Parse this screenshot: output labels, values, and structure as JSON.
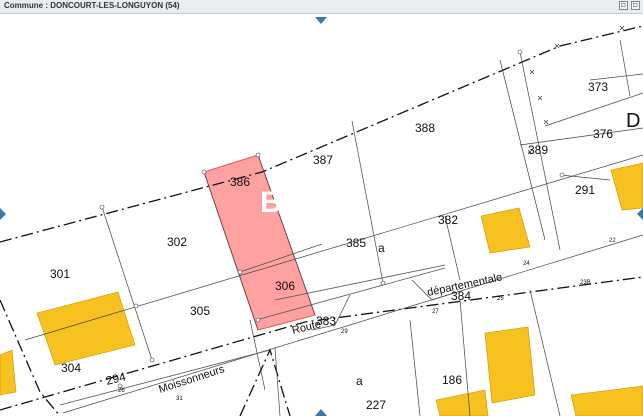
{
  "window": {
    "title": "Commune : DONCOURT-LES-LONGUYON (54)",
    "buttons": [
      {
        "name": "minimize-button",
        "glyph": "▫"
      },
      {
        "name": "restore-button",
        "glyph": "▫"
      }
    ]
  },
  "map": {
    "parcels": {
      "p373": "373",
      "p376": "376",
      "p388": "388",
      "p389": "389",
      "p387": "387",
      "p386": "386",
      "p291": "291",
      "p382": "382",
      "p302": "302",
      "p385": "385",
      "p301": "301",
      "p306": "306",
      "p305": "305",
      "p384": "384",
      "p383": "383",
      "p304": "304",
      "p294": "294",
      "p186": "186",
      "p227": "227"
    },
    "letters": {
      "a1": "a",
      "a2": "a",
      "big_d": "D",
      "watermark": "B"
    },
    "small_numbers": {
      "n22": "22",
      "n24": "24",
      "n25": "25",
      "n27": "27",
      "n23b": "23B",
      "n26": "26",
      "n29": "29",
      "n31": "31"
    },
    "roads": {
      "departementale": "départementale",
      "route": "Route",
      "moissonneurs": "Moissonneurs"
    },
    "selected_parcel_color": "#ff8a8a",
    "building_color": "#f7c11f",
    "nav_color": "#3a78b5"
  }
}
